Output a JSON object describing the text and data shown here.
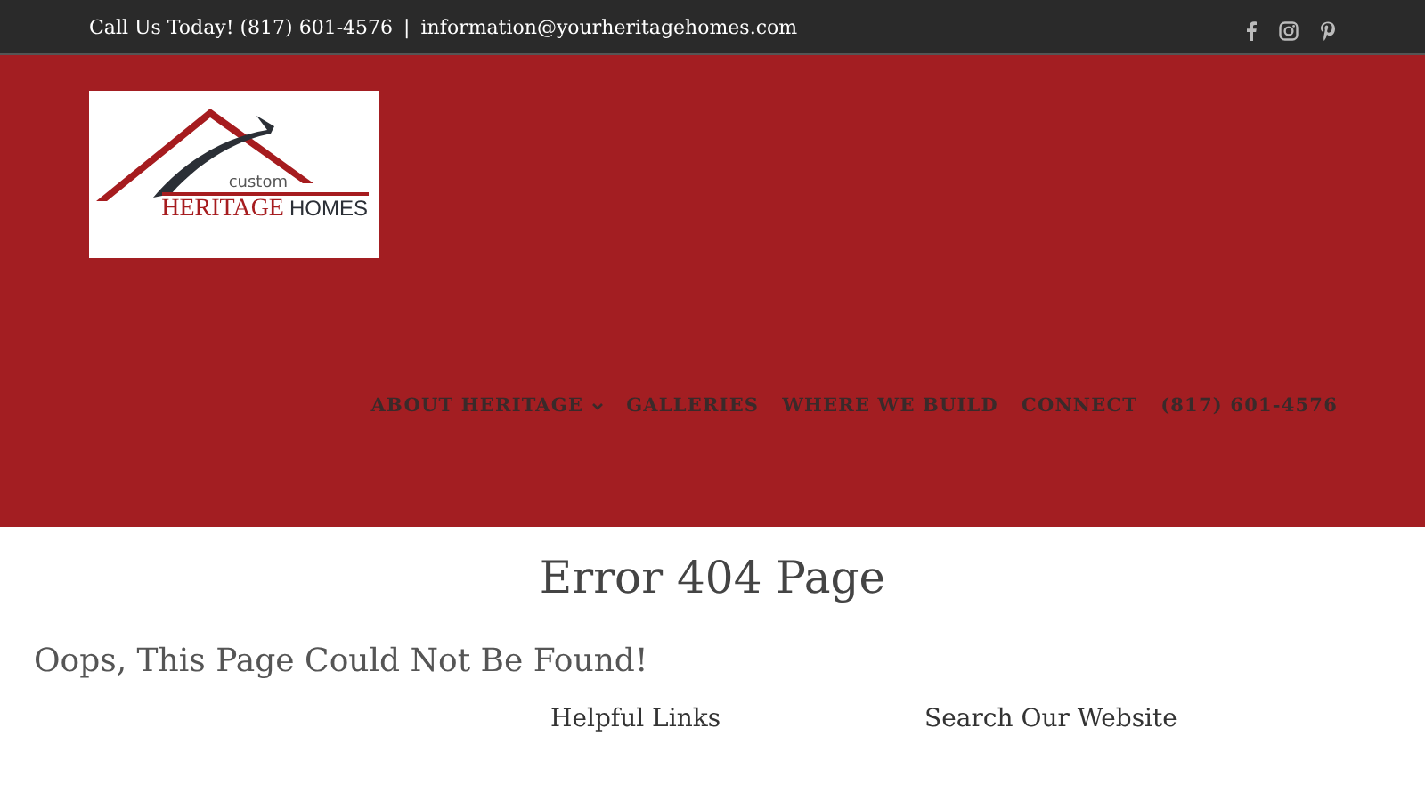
{
  "top_bar": {
    "phone_text": "Call Us Today! (817) 601-4576",
    "separator": "|",
    "email": "information@yourheritagehomes.com"
  },
  "logo": {
    "small_word": "custom",
    "main_word": "HERITAGE",
    "second_word": "HOMES"
  },
  "nav": [
    {
      "label": "ABOUT HERITAGE",
      "has_dropdown": true
    },
    {
      "label": "GALLERIES",
      "has_dropdown": false
    },
    {
      "label": "WHERE WE BUILD",
      "has_dropdown": false
    },
    {
      "label": "CONNECT",
      "has_dropdown": false
    },
    {
      "label": "(817) 601-4576",
      "has_dropdown": false
    }
  ],
  "page_title": "Error 404 Page",
  "subtitle": "Oops, This Page Could Not Be Found!",
  "columns": [
    {
      "heading": "Helpful Links"
    },
    {
      "heading": "Search Our Website"
    }
  ]
}
